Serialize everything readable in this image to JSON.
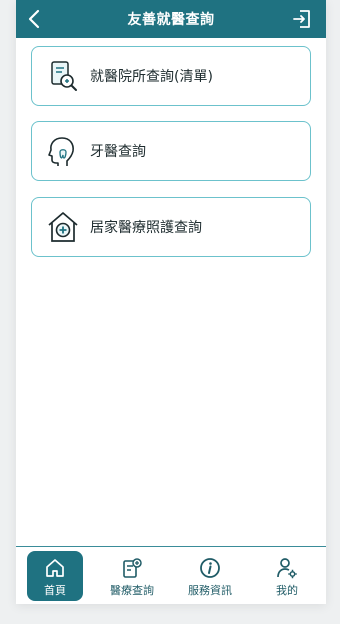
{
  "header": {
    "title": "友善就醫查詢"
  },
  "cards": [
    {
      "label": "就醫院所查詢(清單)",
      "icon": "hospital-search-icon"
    },
    {
      "label": "牙醫查詢",
      "icon": "dental-head-icon"
    },
    {
      "label": "居家醫療照護查詢",
      "icon": "home-care-icon"
    }
  ],
  "tabs": [
    {
      "label": "首頁",
      "icon": "home-icon",
      "active": true
    },
    {
      "label": "醫療查詢",
      "icon": "medical-search-icon",
      "active": false
    },
    {
      "label": "服務資訊",
      "icon": "info-icon",
      "active": false
    },
    {
      "label": "我的",
      "icon": "user-settings-icon",
      "active": false
    }
  ],
  "colors": {
    "primary": "#1f7281",
    "card_border": "#6cc2cc",
    "text": "#1d2b2e"
  }
}
